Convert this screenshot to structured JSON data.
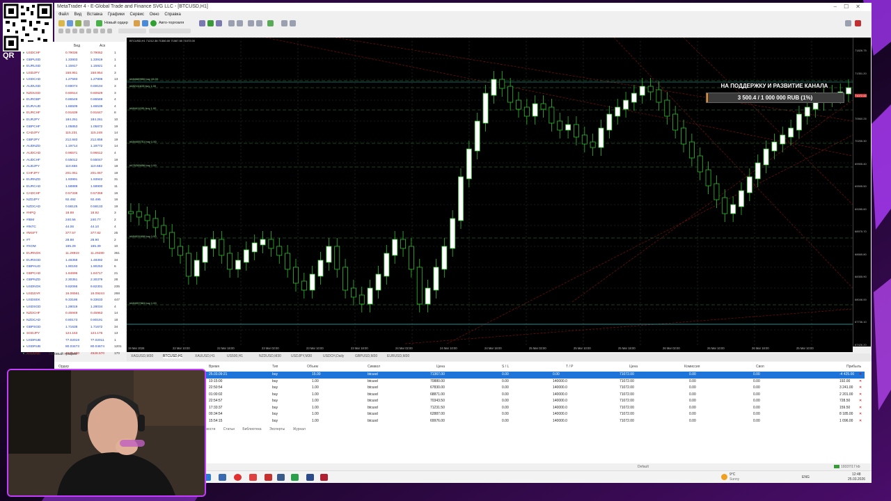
{
  "window": {
    "title": "MetaTrader 4 - E-Global Trade and Finance SVG LLC - [BTCUSD,H1]",
    "menu": [
      "Файл",
      "Вид",
      "Вставка",
      "Графики",
      "Сервис",
      "Окно",
      "Справка"
    ],
    "toolbar": {
      "new_order": "Новый ордер",
      "autotrade": "Авто-торговля"
    }
  },
  "qr_label": "QR",
  "market_watch": {
    "header_bid": "Бид",
    "header_ask": "Аск",
    "rows": [
      {
        "symbol": "USDCHF",
        "bid": "0.79036",
        "ask": "0.79062",
        "spread": "1"
      },
      {
        "symbol": "GBPUSD",
        "bid": "1.33903",
        "ask": "1.33919",
        "spread": "1"
      },
      {
        "symbol": "EURUSD",
        "bid": "1.15917",
        "ask": "1.15921",
        "spread": "4"
      },
      {
        "symbol": "USDJPY",
        "bid": "158.951",
        "ask": "158.954",
        "spread": "3"
      },
      {
        "symbol": "USDCAD",
        "bid": "1.27593",
        "ask": "1.27806",
        "spread": "13"
      },
      {
        "symbol": "AUDUSD",
        "bid": "0.69074",
        "ask": "0.69104",
        "spread": "3"
      },
      {
        "symbol": "NZDUSD",
        "bid": "0.60614",
        "ask": "0.60629",
        "spread": "3"
      },
      {
        "symbol": "EURGBP",
        "bid": "0.86549",
        "ask": "0.86569",
        "spread": "4"
      },
      {
        "symbol": "EURAUD",
        "bid": "1.66509",
        "ask": "1.66539",
        "spread": "4"
      },
      {
        "symbol": "EURCHF",
        "bid": "0.91639",
        "ask": "0.91647",
        "spread": "8"
      },
      {
        "symbol": "EURJPY",
        "bid": "184.251",
        "ask": "184.261",
        "spread": "10"
      },
      {
        "symbol": "GBPCHF",
        "bid": "1.05853",
        "ask": "1.05872",
        "spread": "19"
      },
      {
        "symbol": "CADJPY",
        "bid": "115.231",
        "ask": "115.248",
        "spread": "14"
      },
      {
        "symbol": "GBPJPY",
        "bid": "212.840",
        "ask": "212.858",
        "spread": "19"
      },
      {
        "symbol": "AUDNZD",
        "bid": "1.19714",
        "ask": "1.19772",
        "spread": "14"
      },
      {
        "symbol": "AUDCAD",
        "bid": "0.96571",
        "ask": "0.96612",
        "spread": "4"
      },
      {
        "symbol": "AUDCHF",
        "bid": "0.55012",
        "ask": "0.55047",
        "spread": "19"
      },
      {
        "symbol": "AUDJPY",
        "bid": "110.656",
        "ask": "110.682",
        "spread": "19"
      },
      {
        "symbol": "CHFJPY",
        "bid": "201.051",
        "ask": "201.067",
        "spread": "19"
      },
      {
        "symbol": "EURNZD",
        "bid": "1.93991",
        "ask": "1.93942",
        "spread": "31"
      },
      {
        "symbol": "EURCAD",
        "bid": "1.58889",
        "ask": "1.58900",
        "spread": "11"
      },
      {
        "symbol": "CADCHF",
        "bid": "0.57338",
        "ask": "0.57359",
        "spread": "16"
      },
      {
        "symbol": "NZDJPY",
        "bid": "92.492",
        "ask": "92.495",
        "spread": "16"
      },
      {
        "symbol": "NZDCAD",
        "bid": "0.58125",
        "ask": "0.58133",
        "spread": "19"
      },
      {
        "symbol": "#HPQ",
        "bid": "18.89",
        "ask": "18.92",
        "spread": "3"
      },
      {
        "symbol": "#IBM",
        "bid": "240.56",
        "ask": "240.77",
        "spread": "2"
      },
      {
        "symbol": "#INTC",
        "bid": "44.06",
        "ask": "44.10",
        "spread": "4"
      },
      {
        "symbol": "#MSFT",
        "bid": "377.57",
        "ask": "377.82",
        "spread": "25"
      },
      {
        "symbol": "#T",
        "bid": "28.88",
        "ask": "28.90",
        "spread": "2"
      },
      {
        "symbol": "#XOM",
        "bid": "165.29",
        "ask": "165.39",
        "spread": "10"
      },
      {
        "symbol": "EURNOK",
        "bid": "11.28919",
        "ask": "11.29280",
        "spread": "361"
      },
      {
        "symbol": "EURSGD",
        "bid": "1.48358",
        "ask": "1.48392",
        "spread": "34"
      },
      {
        "symbol": "GBPAUD",
        "bid": "1.90193",
        "ask": "1.90253",
        "spread": "6"
      },
      {
        "symbol": "GBPCAD",
        "bid": "1.84696",
        "ask": "1.84717",
        "spread": "21"
      },
      {
        "symbol": "GBPNZD",
        "bid": "2.30351",
        "ask": "2.30379",
        "spread": "28"
      },
      {
        "symbol": "USDNOK",
        "bid": "9.82066",
        "ask": "9.82301",
        "spread": "235"
      },
      {
        "symbol": "USDZAR",
        "bid": "16.06561",
        "ask": "16.09244",
        "spread": "268"
      },
      {
        "symbol": "USDSEK",
        "bid": "9.33186",
        "ask": "9.33633",
        "spread": "447"
      },
      {
        "symbol": "USDSGD",
        "bid": "1.28019",
        "ask": "1.28034",
        "spread": "4"
      },
      {
        "symbol": "NZDCHF",
        "bid": "0.45949",
        "ask": "0.45963",
        "spread": "14"
      },
      {
        "symbol": "NZDCAD",
        "bid": "0.80173",
        "ask": "0.80191",
        "spread": "18"
      },
      {
        "symbol": "GBPSGD",
        "bid": "1.71638",
        "ask": "1.71672",
        "spread": "34"
      },
      {
        "symbol": "SGDJPY",
        "bid": "124.163",
        "ask": "124.176",
        "spread": "13"
      },
      {
        "symbol": "USDRUB",
        "bid": "77.02019",
        "ask": "77.02011",
        "spread": "1"
      },
      {
        "symbol": "USDRUB",
        "bid": "80.03473",
        "ask": "80.04674",
        "spread": "1201"
      },
      {
        "symbol": "XAUUSD",
        "bid": "4528.400",
        "ask": "4528.570",
        "spread": "170"
      }
    ],
    "tabs": [
      "Символы",
      "Тиковый график"
    ]
  },
  "chart": {
    "symbol_label": "BTCUSD,H1  71212.38 71380.00 71067.50 71072.00",
    "order_lines": [
      "#484689950 buy 15.00",
      "#482111628 buy 1.00",
      "#484411281 buy 1.00",
      "#484405751 buy 1.00",
      "#476265656 buy 1.00",
      "#484031608 buy 1.00",
      "#484057863 buy 1.00"
    ],
    "price_ticks": [
      "71826.75",
      "71351.20",
      "71072.00",
      "70560.25",
      "70255.30",
      "69905.40",
      "69595.50",
      "69285.60",
      "68975.70",
      "68665.80",
      "68355.90",
      "68046.00",
      "67736.10",
      "67426.20"
    ],
    "time_ticks": [
      "19 Mar 2026",
      "22 Mar 10:00",
      "22 Mar 18:00",
      "23 Mar 02:00",
      "23 Mar 10:00",
      "23 Mar 18:00",
      "24 Mar 02:00",
      "24 Mar 10:00",
      "24 Mar 18:00",
      "25 Mar 02:00",
      "25 Mar 10:00",
      "25 Mar 18:00",
      "26 Mar 02:00",
      "26 Mar 10:00",
      "26 Mar 18:00",
      "25 Mar 10:00"
    ],
    "tabs": [
      "XAGUSD,M30",
      "BTCUSD,H1",
      "XAUUSD,H1",
      "US500,H1",
      "NZDUSD,M30",
      "USDJPY,M30",
      "USDCH,Daily",
      "GBPUSD,M30",
      "EURUSD,M30"
    ]
  },
  "donation": {
    "title": "НА ПОДДЕРЖКУ И РАЗВИТИЕ КАНАЛА",
    "progress_text": "3 500.4 / 1 000 000 RUB (1%)",
    "percent": 1,
    "accent": "#f08a1e"
  },
  "terminal": {
    "headers": [
      "Ордер",
      "Время",
      "Тип",
      "Объем",
      "Символ",
      "Цена",
      "S / L",
      "T / P",
      "Цена",
      "Комиссия",
      "Своп",
      "Прибыль"
    ],
    "rows": [
      {
        "time": "25.03.09:21",
        "type": "buy",
        "vol": "15.00",
        "sym": "btcusd",
        "price": "71367.00",
        "sl": "0.00",
        "tp": "0.00",
        "cur": "71072.00",
        "comm": "0.00",
        "swap": "0.00",
        "profit": "-4 425.00"
      },
      {
        "time": "10:15:00",
        "type": "buy",
        "vol": "1.00",
        "sym": "btcusd",
        "price": "70880.00",
        "sl": "0.00",
        "tp": "140000.0",
        "cur": "71072.00",
        "comm": "0.00",
        "swap": "0.00",
        "profit": "192.00"
      },
      {
        "time": "22:50:54",
        "type": "buy",
        "vol": "1.00",
        "sym": "btcusd",
        "price": "67830.00",
        "sl": "0.00",
        "tp": "140000.0",
        "cur": "71072.00",
        "comm": "0.00",
        "swap": "0.00",
        "profit": "3 241.00"
      },
      {
        "time": "01:00:02",
        "type": "buy",
        "vol": "1.00",
        "sym": "btcusd",
        "price": "68871.00",
        "sl": "0.00",
        "tp": "140000.0",
        "cur": "71072.00",
        "comm": "0.00",
        "swap": "0.00",
        "profit": "2 201.00"
      },
      {
        "time": "22:54:57",
        "type": "buy",
        "vol": "1.00",
        "sym": "btcusd",
        "price": "70343.50",
        "sl": "0.00",
        "tp": "140000.0",
        "cur": "71072.00",
        "comm": "0.00",
        "swap": "0.00",
        "profit": "728.50"
      },
      {
        "time": "17:33:37",
        "type": "buy",
        "vol": "1.00",
        "sym": "btcusd",
        "price": "71231.50",
        "sl": "0.00",
        "tp": "140000.0",
        "cur": "71072.00",
        "comm": "0.00",
        "swap": "0.00",
        "profit": "159.50"
      },
      {
        "time": "00:34:54",
        "type": "buy",
        "vol": "1.00",
        "sym": "btcusd",
        "price": "62887.00",
        "sl": "0.00",
        "tp": "140000.0",
        "cur": "71072.00",
        "comm": "0.00",
        "swap": "0.00",
        "profit": "8 185.00"
      },
      {
        "time": "15:54:15",
        "type": "buy",
        "vol": "1.00",
        "sym": "btcusd",
        "price": "69976.00",
        "sl": "0.00",
        "tp": "140000.0",
        "cur": "71072.00",
        "comm": "0.00",
        "swap": "0.00",
        "profit": "1 096.00"
      }
    ],
    "tabs": [
      "Новости",
      "Статьи",
      "Библиотека",
      "Эксперты",
      "Журнал"
    ]
  },
  "statusbar": {
    "profile": "Default",
    "traffic": "19337/17 kb"
  },
  "taskbar": {
    "weather": "9°C",
    "weather_desc": "Sunny",
    "lang": "ENG",
    "time": "12:48",
    "date": "25.03.2026"
  }
}
